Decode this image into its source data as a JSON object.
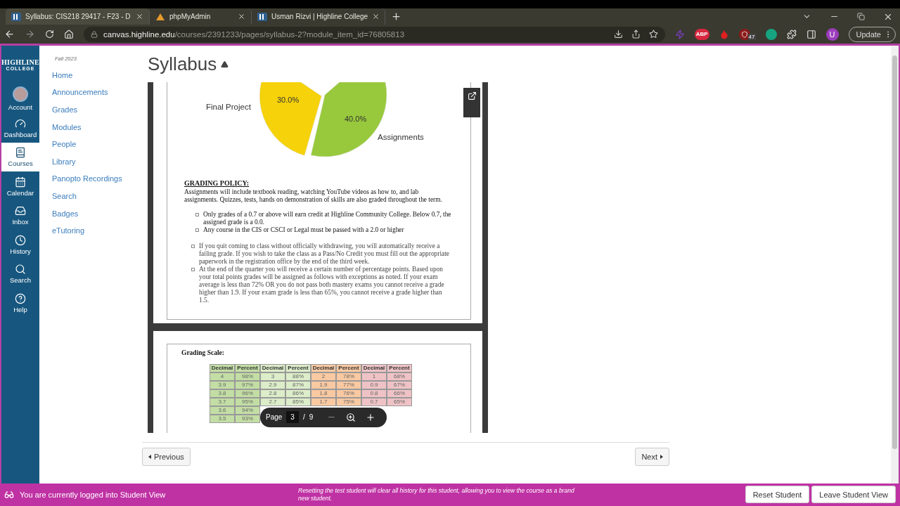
{
  "browser": {
    "tabs": [
      {
        "title": "Syllabus: CIS218 29417 - F23 - D",
        "kind": "college",
        "selected": true
      },
      {
        "title": "phpMyAdmin",
        "kind": "sail",
        "selected": false
      },
      {
        "title": "Usman Rizvi | Highline College",
        "kind": "college",
        "selected": false
      }
    ],
    "url_host": "canvas.highline.edu",
    "url_path": "/courses/2391233/pages/syllabus-2?module_item_id=76805813",
    "extensions": [
      {
        "kind": "bolt"
      },
      {
        "kind": "abp",
        "text": "ABP"
      },
      {
        "kind": "drop"
      },
      {
        "kind": "shield",
        "badge": "47"
      },
      {
        "kind": "grammar"
      }
    ],
    "profile_initial": "U",
    "update_button": "Update"
  },
  "global_nav": {
    "logo_top": "HIGHLINE",
    "logo_bottom": "COLLEGE",
    "items": [
      {
        "label": "Account",
        "kind": "account",
        "selected": false
      },
      {
        "label": "Dashboard",
        "kind": "dashboard",
        "selected": false
      },
      {
        "label": "Courses",
        "kind": "courses",
        "selected": true
      },
      {
        "label": "Calendar",
        "kind": "calendar",
        "selected": false
      },
      {
        "label": "Inbox",
        "kind": "inbox",
        "selected": false
      },
      {
        "label": "History",
        "kind": "history",
        "selected": false
      },
      {
        "label": "Search",
        "kind": "search",
        "selected": false
      },
      {
        "label": "Help",
        "kind": "help",
        "selected": false
      }
    ]
  },
  "course_nav": {
    "term": "Fall 2023",
    "links": [
      "Home",
      "Announcements",
      "Grades",
      "Modules",
      "People",
      "Library",
      "Panopto Recordings",
      "Search",
      "Badges",
      "eTutoring"
    ]
  },
  "page": {
    "title": "Syllabus"
  },
  "document": {
    "chart_data": {
      "type": "pie",
      "categories": [
        "Assignments",
        "Final Project"
      ],
      "values": [
        40,
        30
      ],
      "value_labels": [
        "40.0%",
        "30.0%"
      ],
      "colors": [
        "#98c93c",
        "#f5d20a"
      ]
    },
    "policy_heading": "GRADING POLICY:",
    "policy_intro": "Assignments will include textbook reading, watching YouTube videos as how to, and lab assignments. Quizzes, tests, hands on demonstration of skills are also graded throughout the term.",
    "bullets": [
      "Only grades of a 0.7 or above will earn credit at Highline Community College. Below 0.7, the assigned grade is a 0.0.",
      "Any course in the CIS or CSCI or Legal must be passed with a 2.0 or higher"
    ],
    "notes": [
      "If you quit coming to class without officially withdrawing, you will automatically receive a failing grade.  If you wish to take the class as a Pass/No Credit you must fill out the appropriate paperwork in the registration office by the end of the third week.",
      "At the end of the quarter you will receive a certain number of percentage points. Based upon your total points grades will be assigned as follows with exceptions as noted. If your exam average is less than 72% OR you do not pass both mastery exams you cannot receive a grade higher than 1.9. If your exam grade is less than 65%, you cannot receive a grade higher than 1.5."
    ],
    "scale_heading": "Grading Scale:",
    "scale_columns": [
      {
        "label": "Decimal",
        "color": "#c3dea5"
      },
      {
        "label": "Percent",
        "color": "#c3dea5"
      },
      {
        "label": "Decimal",
        "color": "#dcedc9"
      },
      {
        "label": "Percent",
        "color": "#dcedc9"
      },
      {
        "label": "Decimal",
        "color": "#f9c9a2"
      },
      {
        "label": "Percent",
        "color": "#f9c9a2"
      },
      {
        "label": "Decimal",
        "color": "#efc3c6"
      },
      {
        "label": "Percent",
        "color": "#efc3c6"
      }
    ],
    "scale_rows": [
      [
        "4",
        "98%",
        "3",
        "88%",
        "2",
        "78%",
        "1",
        "68%"
      ],
      [
        "3.9",
        "97%",
        "2.9",
        "87%",
        "1.9",
        "77%",
        "0.9",
        "67%"
      ],
      [
        "3.8",
        "96%",
        "2.8",
        "86%",
        "1.8",
        "76%",
        "0.8",
        "66%"
      ],
      [
        "3.7",
        "95%",
        "2.7",
        "85%",
        "1.7",
        "75%",
        "0.7",
        "65%"
      ],
      [
        "3.6",
        "94%"
      ],
      [
        "3.5",
        "93%"
      ]
    ]
  },
  "pdf_toolbar": {
    "label": "Page",
    "current": "3",
    "separator": "/",
    "total": "9"
  },
  "pager": {
    "previous": "Previous",
    "next": "Next"
  },
  "student_view": {
    "message": "You are currently logged into Student View",
    "notice": "Resetting the test student will clear all history for this student, allowing you to view the course as a brand new student.",
    "buttons": [
      "Reset Student",
      "Leave Student View"
    ]
  }
}
